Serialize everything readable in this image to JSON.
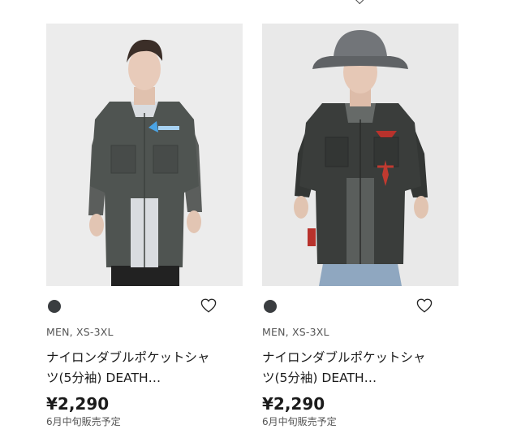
{
  "products": [
    {
      "image_alt": "ナイロンダブルポケットシャツ 着用モデル",
      "swatch_color": "#3a3d40",
      "meta": "MEN, XS-3XL",
      "title_line1": "ナイロンダブルポケットシャ",
      "title_line2": "ツ(5分袖) DEATH…",
      "price": "¥2,290",
      "release": "6月中旬販売予定",
      "favorite_icon": "heart-outline-icon"
    },
    {
      "image_alt": "ナイロンダブルポケットシャツ 着用モデル",
      "swatch_color": "#3a3d40",
      "meta": "MEN, XS-3XL",
      "title_line1": "ナイロンダブルポケットシャ",
      "title_line2": "ツ(5分袖) DEATH…",
      "price": "¥2,290",
      "release": "6月中旬販売予定",
      "favorite_icon": "heart-outline-icon"
    }
  ]
}
